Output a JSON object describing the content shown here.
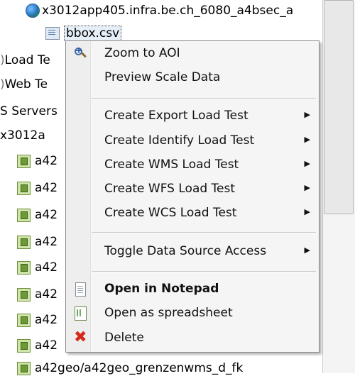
{
  "tree": {
    "top_node": "x3012app405.infra.be.ch_6080_a4bsec_a",
    "selected_file": "bbox.csv",
    "left_labels": [
      "Load Te",
      "Web Te",
      "S Servers",
      "x3012a"
    ],
    "service_prefix": "a42",
    "bottom_node": "a42geo/a42geo_grenzenwms_d_fk"
  },
  "menu": {
    "zoom_to_aoi": "Zoom to AOI",
    "preview_scale_data": "Preview Scale Data",
    "create_export": "Create Export Load Test",
    "create_identify": "Create Identify Load Test",
    "create_wms": "Create WMS Load Test",
    "create_wfs": "Create WFS Load Test",
    "create_wcs": "Create WCS Load Test",
    "toggle_access": "Toggle Data Source Access",
    "open_notepad": "Open in Notepad",
    "open_spreadsheet": "Open as spreadsheet",
    "delete": "Delete",
    "submenu_arrow": "▶"
  },
  "icons": {
    "zoom": "zoom-in-icon",
    "notepad": "notepad-icon",
    "spreadsheet": "spreadsheet-icon",
    "delete": "delete-icon",
    "service": "service-icon",
    "globe": "globe-icon",
    "file": "csv-file-icon"
  },
  "colors": {
    "delete_red": "#d42a1a",
    "menu_bg": "#f5f5f5"
  }
}
